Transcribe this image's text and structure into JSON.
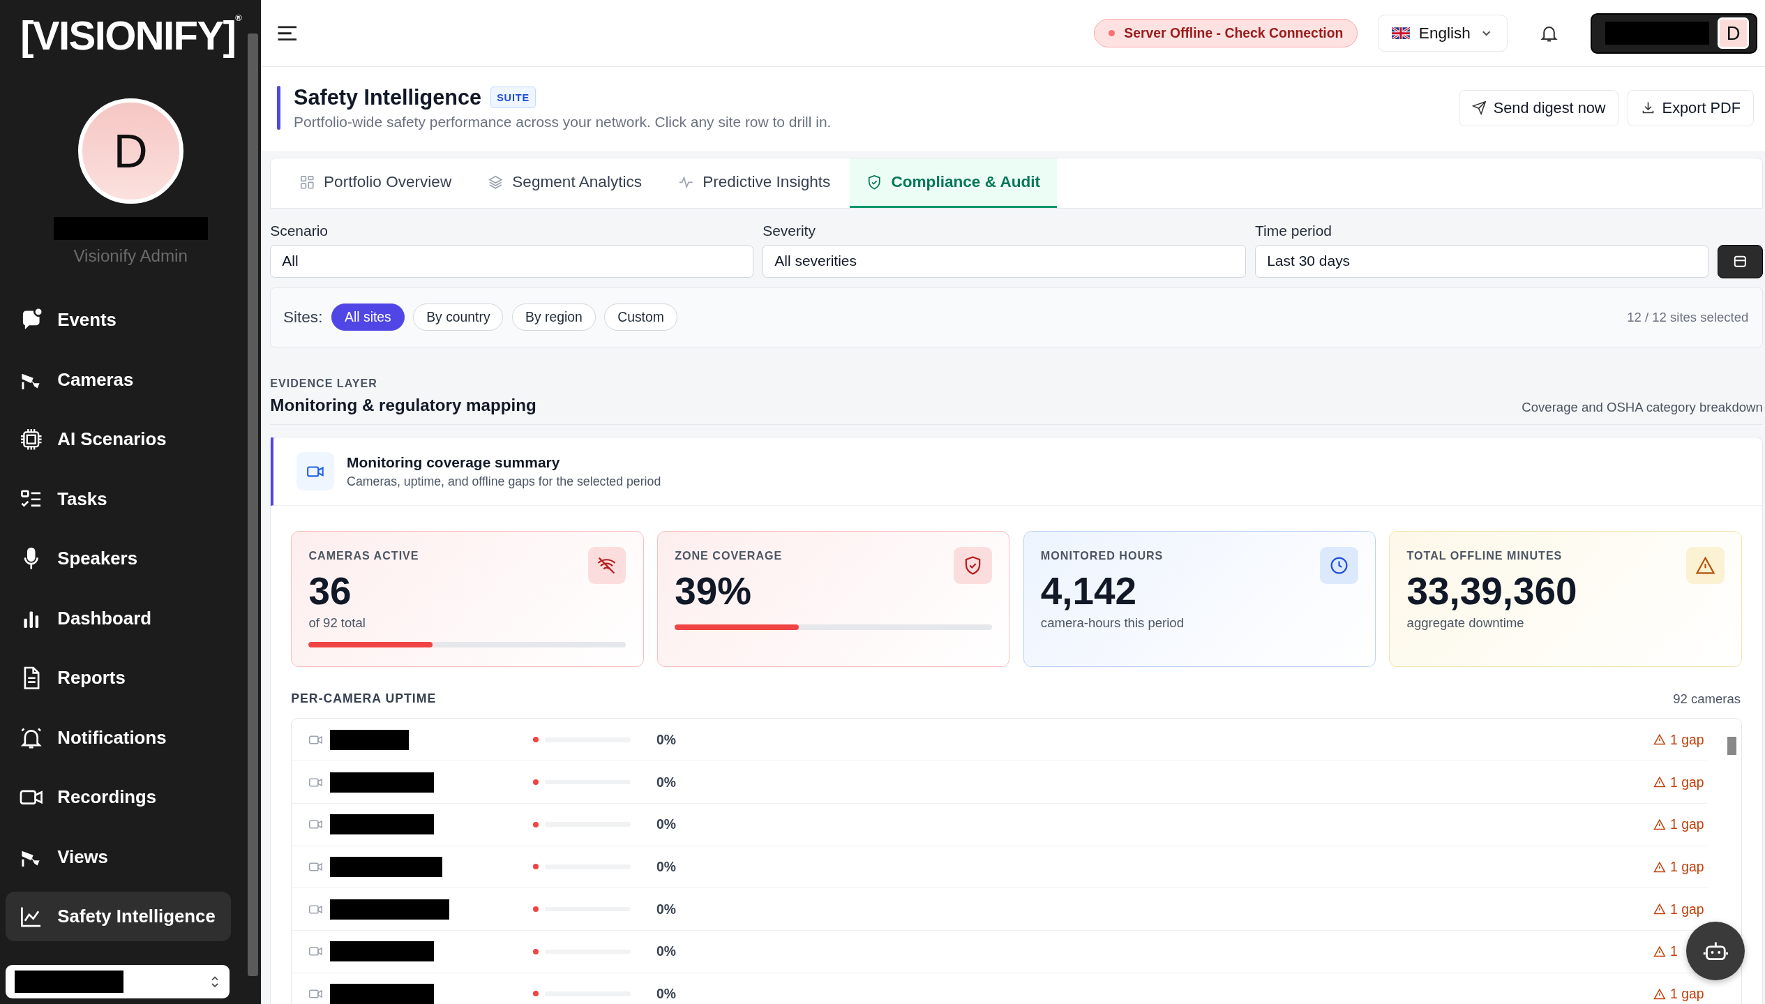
{
  "sidebar": {
    "logo": "[VISIONIFY]",
    "logo_mark": "®",
    "avatar_letter": "D",
    "role": "Visionify Admin",
    "items": [
      {
        "label": "Events",
        "selected": false
      },
      {
        "label": "Cameras",
        "selected": false
      },
      {
        "label": "AI Scenarios",
        "selected": false
      },
      {
        "label": "Tasks",
        "selected": false
      },
      {
        "label": "Speakers",
        "selected": false
      },
      {
        "label": "Dashboard",
        "selected": false
      },
      {
        "label": "Reports",
        "selected": false
      },
      {
        "label": "Notifications",
        "selected": false
      },
      {
        "label": "Recordings",
        "selected": false
      },
      {
        "label": "Views",
        "selected": false
      },
      {
        "label": "Safety Intelligence",
        "selected": true
      }
    ]
  },
  "topbar": {
    "status": "Server Offline - Check Connection",
    "language": "English",
    "user_letter": "D"
  },
  "header": {
    "title": "Safety Intelligence",
    "badge": "SUITE",
    "subtitle": "Portfolio-wide safety performance across your network. Click any site row to drill in.",
    "buttons": [
      "Send digest now",
      "Export PDF"
    ]
  },
  "tabs": [
    {
      "label": "Portfolio Overview",
      "selected": false
    },
    {
      "label": "Segment Analytics",
      "selected": false
    },
    {
      "label": "Predictive Insights",
      "selected": false
    },
    {
      "label": "Compliance & Audit",
      "selected": true
    }
  ],
  "filters": [
    {
      "label": "Scenario",
      "value": "All"
    },
    {
      "label": "Severity",
      "value": "All severities"
    },
    {
      "label": "Time period",
      "value": "Last 30 days"
    }
  ],
  "sites": {
    "label": "Sites:",
    "chips": [
      {
        "label": "All sites",
        "selected": true
      },
      {
        "label": "By country",
        "selected": false
      },
      {
        "label": "By region",
        "selected": false
      },
      {
        "label": "Custom",
        "selected": false
      }
    ],
    "count": "12 / 12 sites selected"
  },
  "section": {
    "eyebrow": "EVIDENCE LAYER",
    "title": "Monitoring & regulatory mapping",
    "note": "Coverage and OSHA category breakdown"
  },
  "summary": {
    "title": "Monitoring coverage summary",
    "subtitle": "Cameras, uptime, and offline gaps for the selected period"
  },
  "cards": [
    {
      "kind": "cameras",
      "label": "CAMERAS ACTIVE",
      "value": "36",
      "caption": "of 92 total",
      "level": 0.39
    },
    {
      "kind": "coverage",
      "label": "ZONE COVERAGE",
      "value": "39%",
      "level": 0.39
    },
    {
      "kind": "hours",
      "label": "MONITORED HOURS",
      "value": "4,142",
      "caption": "camera-hours this period"
    },
    {
      "kind": "offline",
      "label": "TOTAL OFFLINE MINUTES",
      "value": "33,39,360",
      "caption": "aggregate downtime"
    }
  ],
  "uptime": {
    "title": "PER-CAMERA UPTIME",
    "count": "92 cameras",
    "rows": [
      {
        "level": 0,
        "reading": "0%",
        "gaps": "1 gap"
      },
      {
        "level": 0,
        "reading": "0%",
        "gaps": "1 gap"
      },
      {
        "level": 0,
        "reading": "0%",
        "gaps": "1 gap"
      },
      {
        "level": 0,
        "reading": "0%",
        "gaps": "1 gap"
      },
      {
        "level": 0,
        "reading": "0%",
        "gaps": "1 gap"
      },
      {
        "level": 0,
        "reading": "0%",
        "gaps": "1"
      },
      {
        "level": 0,
        "reading": "0%",
        "gaps": "1 gap"
      }
    ]
  }
}
